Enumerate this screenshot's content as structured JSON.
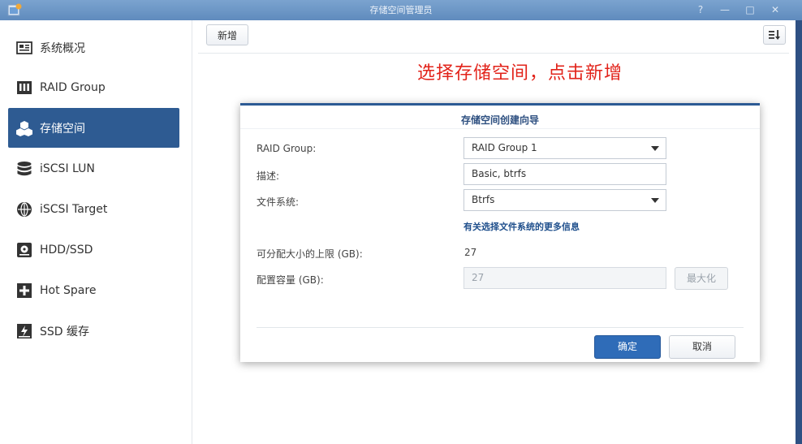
{
  "window": {
    "title": "存储空间管理员",
    "controls": [
      "?",
      "—",
      "□",
      "✕"
    ]
  },
  "sidebar": {
    "items": [
      {
        "label": "系统概况",
        "icon": "overview-icon",
        "active": false
      },
      {
        "label": "RAID Group",
        "icon": "raid-group-icon",
        "active": false
      },
      {
        "label": "存储空间",
        "icon": "volume-cubes-icon",
        "active": true
      },
      {
        "label": "iSCSI LUN",
        "icon": "database-icon",
        "active": false
      },
      {
        "label": "iSCSI Target",
        "icon": "globe-icon",
        "active": false
      },
      {
        "label": "HDD/SSD",
        "icon": "hdd-icon",
        "active": false
      },
      {
        "label": "Hot Spare",
        "icon": "hot-spare-plus-icon",
        "active": false
      },
      {
        "label": "SSD 缓存",
        "icon": "ssd-cache-icon",
        "active": false
      }
    ]
  },
  "toolbar": {
    "create_label": "新增"
  },
  "annotation": "选择存储空间，点击新增",
  "dialog": {
    "title": "存储空间创建向导",
    "raid_group_label": "RAID Group:",
    "raid_group_value": "RAID Group 1",
    "description_label": "描述:",
    "description_value": "Basic, btrfs",
    "filesystem_label": "文件系统:",
    "filesystem_value": "Btrfs",
    "filesystem_info_link": "有关选择文件系统的更多信息",
    "max_size_label": "可分配大小的上限 (GB):",
    "max_size_value": "27",
    "capacity_label": "配置容量 (GB):",
    "capacity_value": "27",
    "maximize_label": "最大化",
    "ok_label": "确定",
    "cancel_label": "取消"
  },
  "colors": {
    "accent": "#2e5b92",
    "annotation": "#e2231a",
    "primary_button": "#2f6cb8"
  }
}
